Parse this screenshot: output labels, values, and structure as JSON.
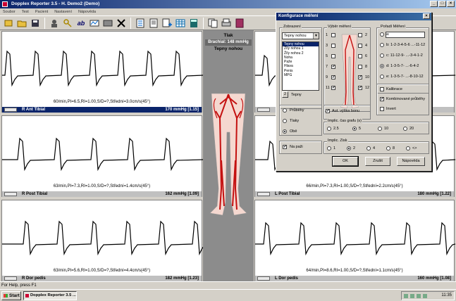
{
  "window": {
    "title": "Dopplex Reporter 3.5 - H. Demo2 (Demo)",
    "buttons": [
      "_",
      "□",
      "×"
    ]
  },
  "menu": [
    "Soubor",
    "Test",
    "Pacient",
    "Nastavení",
    "Nápověda"
  ],
  "toolbar_icons": [
    "new-icon",
    "open-icon",
    "save-icon",
    "patient-icon",
    "key-icon",
    "ab-icon",
    "measure-icon",
    "image-icon",
    "delete-icon",
    "checklist-icon",
    "document-icon",
    "add-document-icon",
    "table-icon",
    "calculator-icon",
    "copy-icon",
    "print-icon",
    "book-icon"
  ],
  "panels": [
    {
      "caption": "60/min,PI=6.5,RI=1.00,S/D=?,Střední=3.0cm/s(45°)",
      "label": "R Ant Tibial",
      "pressure": "170 mmHg [1.15]",
      "active": true
    },
    {
      "caption": "63/min,PI=7.3,RI=1.00,S/D=?,Střední=1.4cm/s(45°)",
      "label": "R Post Tibial",
      "pressure": "162 mmHg [1.09]",
      "active": false
    },
    {
      "caption": "63/min,PI=5.6,RI=1.00,S/D=?,Střední=4.4cm/s(45°)",
      "label": "R Dor pedis",
      "pressure": "182 mmHg [1.23]",
      "active": false
    },
    {
      "caption": "",
      "label": "",
      "pressure": "",
      "active": false
    },
    {
      "caption": "66/min,PI=7.3,RI=1.00,S/D=?,Střední=2.2cm/s(45°)",
      "label": "L Post Tibial",
      "pressure": "180 mmHg [1.22]",
      "active": false
    },
    {
      "caption": "64/min,PI=8.6,RI=1.00,S/D=?,Střední=1.1cm/s(45°)",
      "label": "L Dor pedis",
      "pressure": "160 mmHg [1.08]",
      "active": false
    }
  ],
  "center": {
    "title": "Tlak",
    "brachial": "Brachial: 148 mmHg",
    "subtitle": "Tepny nohou"
  },
  "dialog": {
    "title": "Konfigurace měření",
    "zobrazeni": {
      "label": "Zobrazení",
      "selected": "Tepny nohou",
      "options": [
        "Tepny nohou",
        "Žíly nohou 1",
        "Žíly nohou 2",
        "Noha",
        "Paže",
        "Hlava",
        "Penis",
        "MPG"
      ],
      "count": "2",
      "count_label": "Tepny"
    },
    "vyber": {
      "label": "Výběr měření",
      "checkboxes": [
        {
          "num": "1",
          "checked": false
        },
        {
          "num": "2",
          "checked": false
        },
        {
          "num": "3",
          "checked": false
        },
        {
          "num": "4",
          "checked": false
        },
        {
          "num": "5",
          "checked": false
        },
        {
          "num": "6",
          "checked": false
        },
        {
          "num": "7",
          "checked": true
        },
        {
          "num": "8",
          "checked": false
        },
        {
          "num": "9",
          "checked": true
        },
        {
          "num": "10",
          "checked": true
        },
        {
          "num": "11",
          "checked": true
        },
        {
          "num": "12",
          "checked": true
        }
      ]
    },
    "zobrazit": {
      "options": [
        "Průběhy",
        "Tlaky",
        "Obě"
      ],
      "selected": 2
    },
    "na_paze": {
      "label": "Na paži",
      "checked": true
    },
    "aut_vyska": {
      "label": "Aut. výška bonu",
      "checked": true
    },
    "poradi": {
      "label": "Pořadí Měření",
      "options": [
        "a:",
        "b: 1-2-3-4-5-6 ...-11-12",
        "c: 11-12-9- ...-3-4-1-2",
        "d: 1-3-5-7- ...-6-4-2",
        "e: 1-3-5-7- ...-8-10-12"
      ],
      "selected": 3
    },
    "kalibrace": {
      "label": "Kalibrace",
      "checked": false
    },
    "kombinovane": {
      "label": "Kombinované průběhy",
      "checked": true
    },
    "invert": {
      "label": "Invert",
      "checked": false
    },
    "impl_cas": {
      "label": "Implic. čas grafu (s)",
      "options": [
        "2.5",
        "5",
        "10",
        "20"
      ],
      "selected": 1
    },
    "impl_zisk": {
      "label": "Implic. Zisk",
      "options": [
        "1",
        "2",
        "4",
        "8",
        "<>"
      ],
      "selected": 1
    },
    "buttons": {
      "ok": "OK",
      "cancel": "Zrušit",
      "help": "Nápověda"
    }
  },
  "statusbar": "For Help, press F1",
  "taskbar": {
    "start": "Start",
    "task": "Dopplex Reporter 3.5 ...",
    "time": "11:35"
  }
}
